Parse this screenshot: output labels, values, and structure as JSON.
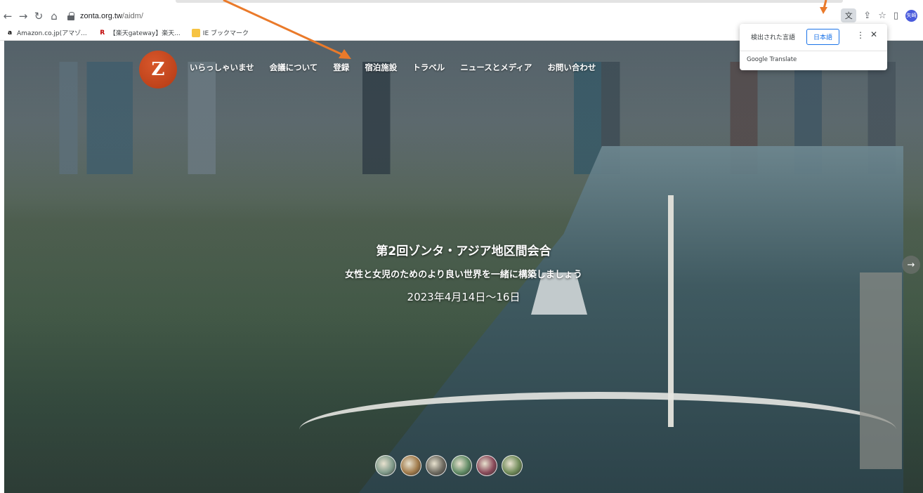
{
  "browser": {
    "url_host": "zonta.org.tw",
    "url_path": "/aidm/",
    "avatar_text": "矢崎"
  },
  "bookmarks": [
    {
      "label": "Amazon.co.jp(アマゾ...",
      "icon": "amazon-icon"
    },
    {
      "label": "【楽天gateway】楽天...",
      "icon": "rakuten-icon"
    },
    {
      "label": "IE ブックマーク",
      "icon": "folder-icon"
    }
  ],
  "site": {
    "logo_glyph": "Z",
    "nav": [
      "いらっしゃいませ",
      "会議について",
      "登録",
      "宿泊施設",
      "トラベル",
      "ニュースとメディア",
      "お問い合わせ"
    ],
    "hero_title": "第2回ゾンタ・アジア地区間会合",
    "hero_subtitle": "女性と女児のためのより良い世界を一緒に構築しましょう",
    "hero_date": "2023年4月14日～16日",
    "thumb_colors": [
      "#7f9a8a",
      "#a07a4a",
      "#6d6a60",
      "#5f8a64",
      "#8a4a5a",
      "#6f8a58"
    ]
  },
  "translate_popup": {
    "detected_label": "検出された言語",
    "target_label": "日本語",
    "brand": "Google Translate"
  },
  "colors": {
    "annotation": "#ea7a2a",
    "accent": "#1a73e8"
  }
}
